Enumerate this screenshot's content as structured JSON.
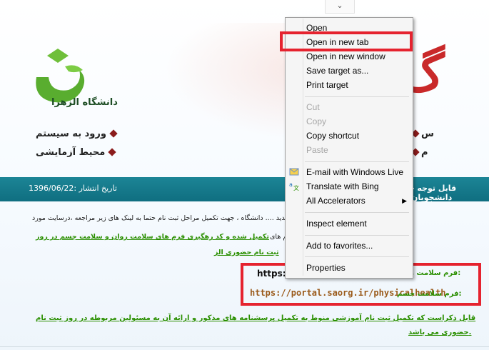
{
  "top_tab_glyph": "⌄",
  "logo": {
    "text": "دانشگاه الزهرا"
  },
  "nav": {
    "left_1": "ورود به سیستم",
    "left_2": "محیط آزمایشی",
    "right_1": "س",
    "right_2": "م"
  },
  "news": {
    "title": "- قابل توجه دانشجویان",
    "date": "تاریخ انتشار :1396/06/22"
  },
  "body": {
    "line1": "کلیه دانشجویان جدید .... دانشگاه ، جهت تکمیل مراحل ثبت نام حتما به لینک های زیر مراجعه ،درسایت مورد",
    "line2_text": "نظر ثبت نام و فرم های",
    "line2_green": "تکمیل شده و کد رهگیری فرم های سلامت روان و سلامت جسم در روز",
    "line3_green": "ثبت نام حضوری الز"
  },
  "forms": {
    "mental_label": "فرم سلامت روان:",
    "mental_url_prefix": "https:/",
    "physical_label": "فرم سلامت جسم:",
    "physical_url": "https://portal.saorg.ir/physicalhealth"
  },
  "bottom_note": {
    "line1": "قابل ذکراست که تکمیل ثبت نام آموزشی منوط به تکمیل پرسشنامه های مذکور و ارائه آن به مسئولین مربوطه در روز ثبت نام",
    "line2": "حضوری می باشد."
  },
  "context_menu": {
    "items": [
      {
        "label": "Open"
      },
      {
        "label": "Open in new tab"
      },
      {
        "label": "Open in new window"
      },
      {
        "label": "Save target as..."
      },
      {
        "label": "Print target"
      },
      {
        "label": "Cut"
      },
      {
        "label": "Copy"
      },
      {
        "label": "Copy shortcut"
      },
      {
        "label": "Paste"
      },
      {
        "label": "E-mail with Windows Live"
      },
      {
        "label": "Translate with Bing"
      },
      {
        "label": "All Accelerators"
      },
      {
        "label": "Inspect element"
      },
      {
        "label": "Add to favorites..."
      },
      {
        "label": "Properties"
      }
    ],
    "icons": {
      "email": "email-icon",
      "translate": "translate-icon",
      "submenu": "submenu-arrow-icon"
    }
  },
  "colors": {
    "highlight": "#e5232f",
    "news_bar": "#1c8596",
    "link_green": "#2a8f00"
  }
}
